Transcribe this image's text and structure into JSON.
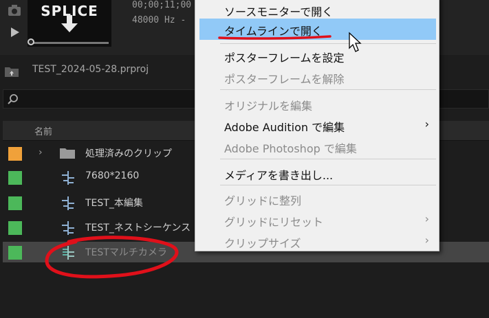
{
  "preview": {
    "thumbnail_text": "SPLICE",
    "timecode": "00;00;11;00",
    "audio": "48000 Hz -"
  },
  "project": {
    "filename": "TEST_2024-05-28.prproj"
  },
  "search": {
    "placeholder": ""
  },
  "list": {
    "header_name": "名前",
    "rows": [
      {
        "label": "処理済みのクリップ",
        "color": "#f0a13a",
        "type": "folder"
      },
      {
        "label": "7680*2160",
        "color": "#4cb85a",
        "type": "sequence"
      },
      {
        "label": "TEST_本編集",
        "color": "#4cb85a",
        "type": "sequence"
      },
      {
        "label": "TEST_ネストシーケンス",
        "color": "#4cb85a",
        "type": "sequence"
      },
      {
        "label": "TESTマルチカメラ",
        "color": "#4cb85a",
        "type": "multicam",
        "selected": true
      }
    ]
  },
  "context_menu": {
    "items": [
      {
        "label": "ソースモニターで開く",
        "enabled": true
      },
      {
        "label": "タイムラインで開く",
        "enabled": true,
        "highlighted": true
      },
      {
        "label": "ポスターフレームを設定",
        "enabled": true
      },
      {
        "label": "ポスターフレームを解除",
        "enabled": false
      },
      {
        "label": "オリジナルを編集",
        "enabled": false
      },
      {
        "label": "Adobe Audition で編集",
        "enabled": true,
        "submenu": true
      },
      {
        "label": "Adobe Photoshop で編集",
        "enabled": false
      },
      {
        "label": "メディアを書き出し...",
        "enabled": true
      },
      {
        "label": "グリッドに整列",
        "enabled": false
      },
      {
        "label": "グリッドにリセット",
        "enabled": false,
        "submenu": true
      },
      {
        "label": "クリップサイズ",
        "enabled": false,
        "submenu": true
      }
    ]
  },
  "colors": {
    "highlight": "#91c9f7",
    "annotation_red": "#e0101a"
  }
}
